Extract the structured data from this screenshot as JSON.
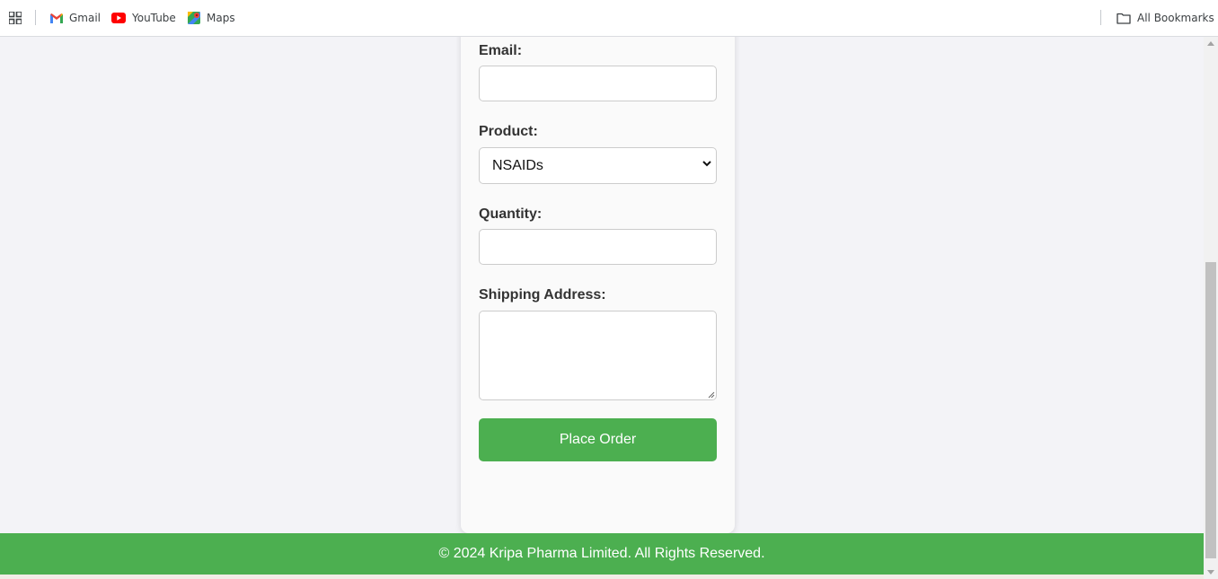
{
  "bookmarks_bar": {
    "items": [
      {
        "label": "Gmail",
        "icon": "gmail-icon"
      },
      {
        "label": "YouTube",
        "icon": "youtube-icon"
      },
      {
        "label": "Maps",
        "icon": "maps-icon"
      }
    ],
    "all_bookmarks_label": "All Bookmarks"
  },
  "order_form": {
    "email_label": "Email:",
    "email_value": "",
    "product_label": "Product:",
    "product_selected": "NSAIDs",
    "quantity_label": "Quantity:",
    "quantity_value": "",
    "address_label": "Shipping Address:",
    "address_value": "",
    "submit_label": "Place Order"
  },
  "footer": {
    "text": "© 2024 Kripa Pharma Limited. All Rights Reserved."
  },
  "colors": {
    "accent": "#4caf50",
    "page_background": "#f3f3f7",
    "card_background": "#fafafa"
  }
}
